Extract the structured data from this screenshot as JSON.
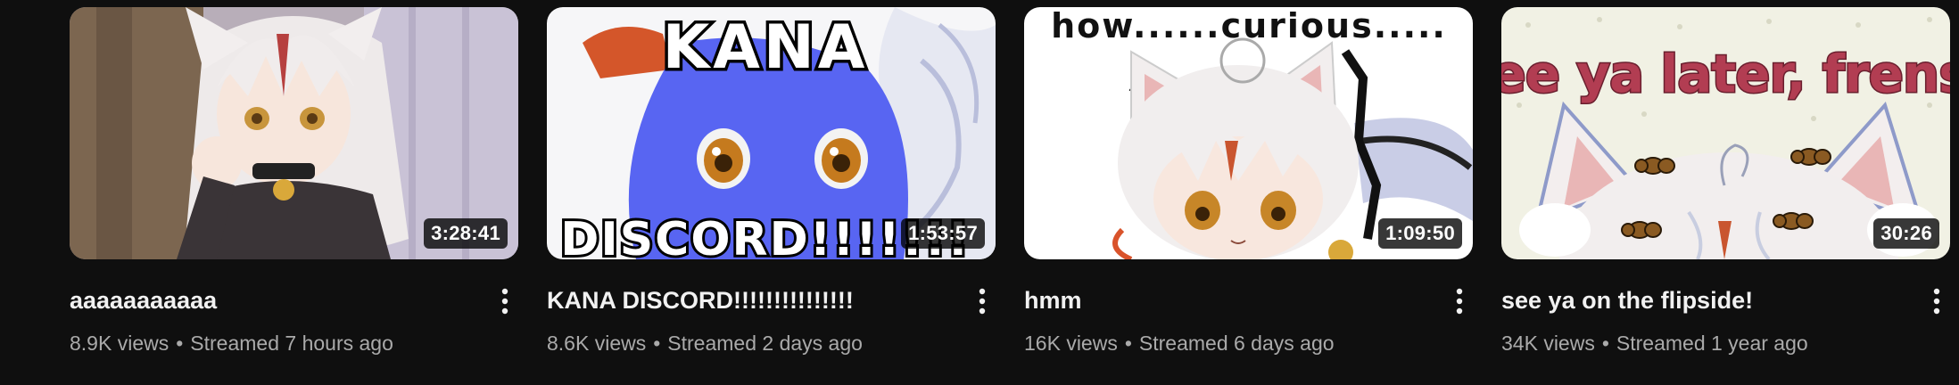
{
  "videos": [
    {
      "duration": "3:28:41",
      "title": "aaaaaaaaaaa",
      "views": "8.9K views",
      "streamed": "Streamed 7 hours ago",
      "thumb_text": ""
    },
    {
      "duration": "1:53:57",
      "title": "KANA DISCORD!!!!!!!!!!!!!!!",
      "views": "8.6K views",
      "streamed": "Streamed 2 days ago",
      "thumb_text_top": "KANA",
      "thumb_text_bottom": "DISCORD!!!!!!!"
    },
    {
      "duration": "1:09:50",
      "title": "hmm",
      "views": "16K views",
      "streamed": "Streamed 6 days ago",
      "thumb_text": "how......curious....."
    },
    {
      "duration": "30:26",
      "title": "see ya on the flipside!",
      "views": "34K views",
      "streamed": "Streamed 1 year ago",
      "thumb_text": "see ya later, frens!"
    }
  ],
  "separator": "•",
  "icons": {
    "menu": "more-vert-icon"
  },
  "colors": {
    "background": "#0f0f0f",
    "title": "#f1f1f1",
    "meta": "#aaaaaa",
    "discord_blue": "#5865f2"
  }
}
